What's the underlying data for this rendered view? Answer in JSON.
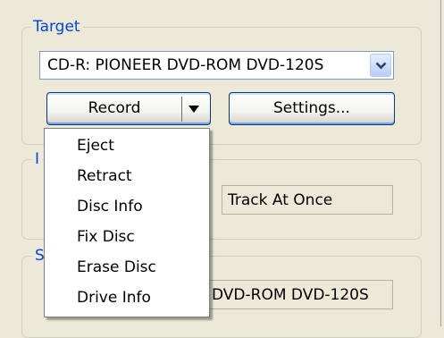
{
  "target_group": {
    "title": "Target"
  },
  "drive_select": {
    "value": "CD-R: PIONEER DVD-ROM DVD-120S"
  },
  "record_button": {
    "label": "Record"
  },
  "settings_button": {
    "label": "Settings..."
  },
  "info_group": {
    "title": "I"
  },
  "write_mode": {
    "value": "Track At Once"
  },
  "status_group": {
    "title": "S"
  },
  "drive_name": {
    "value": "DVD-ROM DVD-120S"
  },
  "record_menu": {
    "items": [
      "Eject",
      "Retract",
      "Disc Info",
      "Fix Disc",
      "Erase Disc",
      "Drive Info"
    ]
  }
}
